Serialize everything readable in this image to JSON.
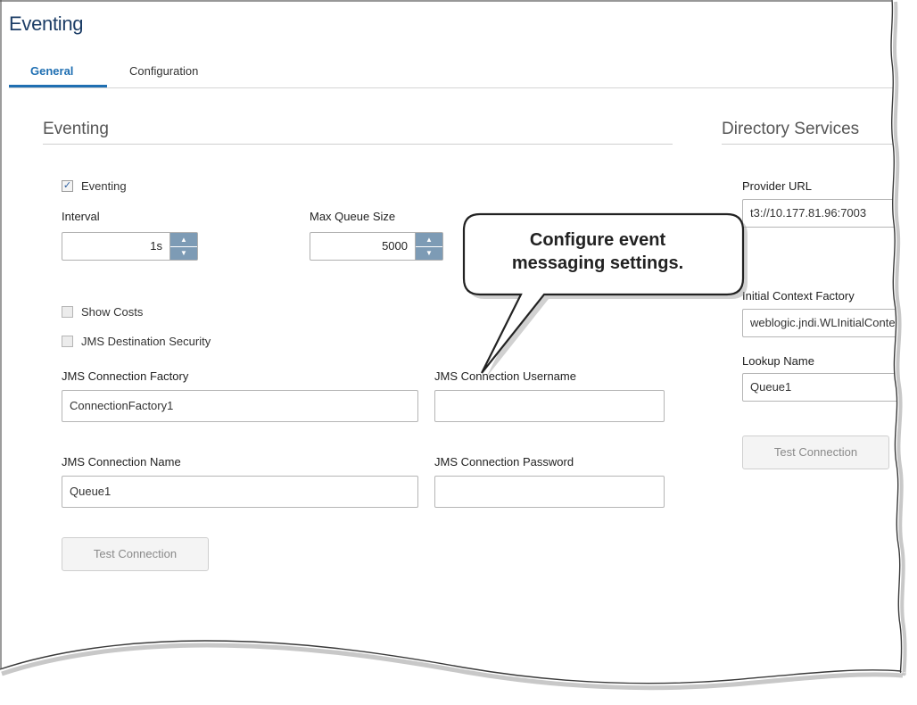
{
  "page": {
    "title": "Eventing"
  },
  "tabs": [
    {
      "label": "General",
      "active": true
    },
    {
      "label": "Configuration",
      "active": false
    }
  ],
  "eventing": {
    "section_title": "Eventing",
    "eventing_checkbox": {
      "label": "Eventing",
      "checked": true
    },
    "interval": {
      "label": "Interval",
      "value": "1s"
    },
    "max_queue_size": {
      "label": "Max Queue Size",
      "value": "5000"
    },
    "show_costs": {
      "label": "Show Costs",
      "checked": false
    },
    "jms_destination_security": {
      "label": "JMS Destination Security",
      "checked": false
    },
    "jms_connection_factory": {
      "label": "JMS Connection Factory",
      "value": "ConnectionFactory1"
    },
    "jms_connection_username": {
      "label": "JMS Connection Username",
      "value": ""
    },
    "jms_connection_name": {
      "label": "JMS Connection Name",
      "value": "Queue1"
    },
    "jms_connection_password": {
      "label": "JMS Connection Password",
      "value": ""
    },
    "test_connection_label": "Test Connection"
  },
  "directory_services": {
    "section_title": "Directory Services",
    "provider_url": {
      "label": "Provider URL",
      "value": "t3://10.177.81.96:7003"
    },
    "initial_context_factory": {
      "label": "Initial Context Factory",
      "value": "weblogic.jndi.WLInitialContextFactory"
    },
    "lookup_name": {
      "label": "Lookup Name",
      "value": "Queue1"
    },
    "test_connection_label": "Test Connection"
  },
  "callout": {
    "line1": "Configure event",
    "line2": "messaging settings."
  },
  "colors": {
    "accent": "#1f6fb2",
    "title": "#1c3d66",
    "spinner": "#7d9bb5"
  }
}
